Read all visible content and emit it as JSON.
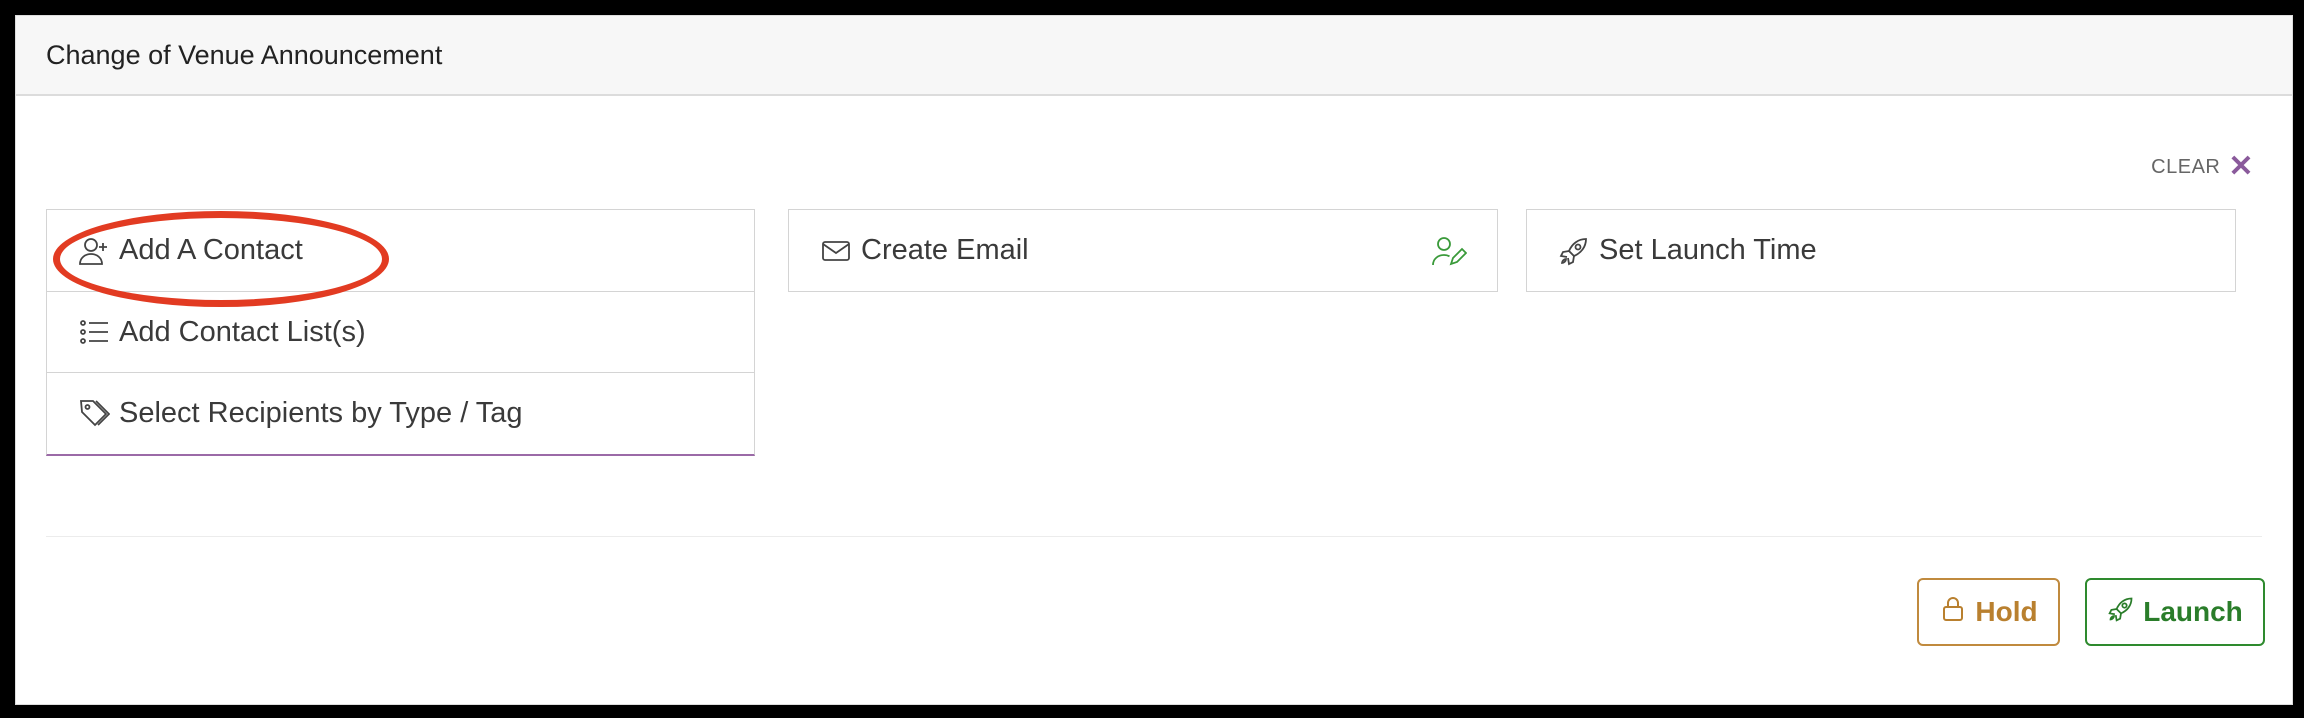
{
  "header": {
    "title": "Change of Venue Announcement"
  },
  "clear": {
    "label": "CLEAR",
    "icon": "close-icon"
  },
  "recipients": {
    "items": [
      {
        "label": "Add A Contact",
        "icon": "user-plus-icon"
      },
      {
        "label": "Add Contact List(s)",
        "icon": "list-icon"
      },
      {
        "label": "Select Recipients by Type / Tag",
        "icon": "tag-icon"
      }
    ]
  },
  "email": {
    "label": "Create Email",
    "icon": "envelope-icon",
    "status_icon": "user-edit-icon"
  },
  "launch_time": {
    "label": "Set Launch Time",
    "icon": "rocket-icon"
  },
  "actions": {
    "hold_label": "Hold",
    "launch_label": "Launch"
  },
  "colors": {
    "accent_purple": "#8a5a9b",
    "hold": "#b9802f",
    "launch": "#2a7d2a",
    "highlight": "#e23b22"
  }
}
